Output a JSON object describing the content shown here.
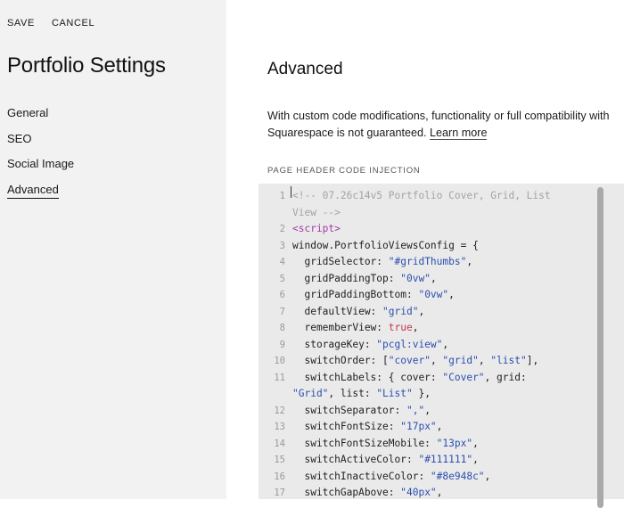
{
  "sidebar": {
    "save_label": "SAVE",
    "cancel_label": "CANCEL",
    "title": "Portfolio Settings",
    "items": [
      {
        "label": "General"
      },
      {
        "label": "SEO"
      },
      {
        "label": "Social Image"
      },
      {
        "label": "Advanced"
      }
    ]
  },
  "main": {
    "title": "Advanced",
    "description": "With custom code modifications, functionality or full compatibility with Squarespace is not guaranteed.",
    "learn_more": "Learn more",
    "section_label": "PAGE HEADER CODE INJECTION"
  },
  "editor": {
    "lines": [
      {
        "n": "1",
        "parts": [
          [
            "cmt",
            "<!-- 07.26c14v5 Portfolio Cover, Grid, List"
          ]
        ],
        "cont": [
          [
            "cmt",
            "View -->"
          ]
        ]
      },
      {
        "n": "2",
        "parts": [
          [
            "tag",
            "<script>"
          ]
        ]
      },
      {
        "n": "3",
        "parts": [
          [
            "plain",
            "window.PortfolioViewsConfig = {"
          ]
        ]
      },
      {
        "n": "4",
        "parts": [
          [
            "plain",
            "  gridSelector: "
          ],
          [
            "str",
            "\"#gridThumbs\""
          ],
          [
            "plain",
            ","
          ]
        ]
      },
      {
        "n": "5",
        "parts": [
          [
            "plain",
            "  gridPaddingTop: "
          ],
          [
            "str",
            "\"0vw\""
          ],
          [
            "plain",
            ","
          ]
        ]
      },
      {
        "n": "6",
        "parts": [
          [
            "plain",
            "  gridPaddingBottom: "
          ],
          [
            "str",
            "\"0vw\""
          ],
          [
            "plain",
            ","
          ]
        ]
      },
      {
        "n": "7",
        "parts": [
          [
            "plain",
            "  defaultView: "
          ],
          [
            "str",
            "\"grid\""
          ],
          [
            "plain",
            ","
          ]
        ]
      },
      {
        "n": "8",
        "parts": [
          [
            "plain",
            "  rememberView: "
          ],
          [
            "kw",
            "true"
          ],
          [
            "plain",
            ","
          ]
        ]
      },
      {
        "n": "9",
        "parts": [
          [
            "plain",
            "  storageKey: "
          ],
          [
            "str",
            "\"pcgl:view\""
          ],
          [
            "plain",
            ","
          ]
        ]
      },
      {
        "n": "10",
        "parts": [
          [
            "plain",
            "  switchOrder: ["
          ],
          [
            "str",
            "\"cover\""
          ],
          [
            "plain",
            ", "
          ],
          [
            "str",
            "\"grid\""
          ],
          [
            "plain",
            ", "
          ],
          [
            "str",
            "\"list\""
          ],
          [
            "plain",
            "],"
          ]
        ]
      },
      {
        "n": "11",
        "parts": [
          [
            "plain",
            "  switchLabels: { cover: "
          ],
          [
            "str",
            "\"Cover\""
          ],
          [
            "plain",
            ", grid:"
          ]
        ],
        "cont": [
          [
            "str",
            "\"Grid\""
          ],
          [
            "plain",
            ", list: "
          ],
          [
            "str",
            "\"List\""
          ],
          [
            "plain",
            " },"
          ]
        ]
      },
      {
        "n": "12",
        "parts": [
          [
            "plain",
            "  switchSeparator: "
          ],
          [
            "str",
            "\",\""
          ],
          [
            "plain",
            ","
          ]
        ]
      },
      {
        "n": "13",
        "parts": [
          [
            "plain",
            "  switchFontSize: "
          ],
          [
            "str",
            "\"17px\""
          ],
          [
            "plain",
            ","
          ]
        ]
      },
      {
        "n": "14",
        "parts": [
          [
            "plain",
            "  switchFontSizeMobile: "
          ],
          [
            "str",
            "\"13px\""
          ],
          [
            "plain",
            ","
          ]
        ]
      },
      {
        "n": "15",
        "parts": [
          [
            "plain",
            "  switchActiveColor: "
          ],
          [
            "str",
            "\"#111111\""
          ],
          [
            "plain",
            ","
          ]
        ]
      },
      {
        "n": "16",
        "parts": [
          [
            "plain",
            "  switchInactiveColor: "
          ],
          [
            "str",
            "\"#8e948c\""
          ],
          [
            "plain",
            ","
          ]
        ]
      },
      {
        "n": "17",
        "parts": [
          [
            "plain",
            "  switchGapAbove: "
          ],
          [
            "str",
            "\"40px\""
          ],
          [
            "plain",
            ","
          ]
        ]
      }
    ]
  },
  "colors": {
    "sidebar_bg": "#f2f2f2",
    "editor_bg": "#eaeaea",
    "string": "#2b4fb0",
    "tag": "#a23ea1",
    "keyword": "#c23a4a",
    "comment": "#a3a3a3"
  }
}
